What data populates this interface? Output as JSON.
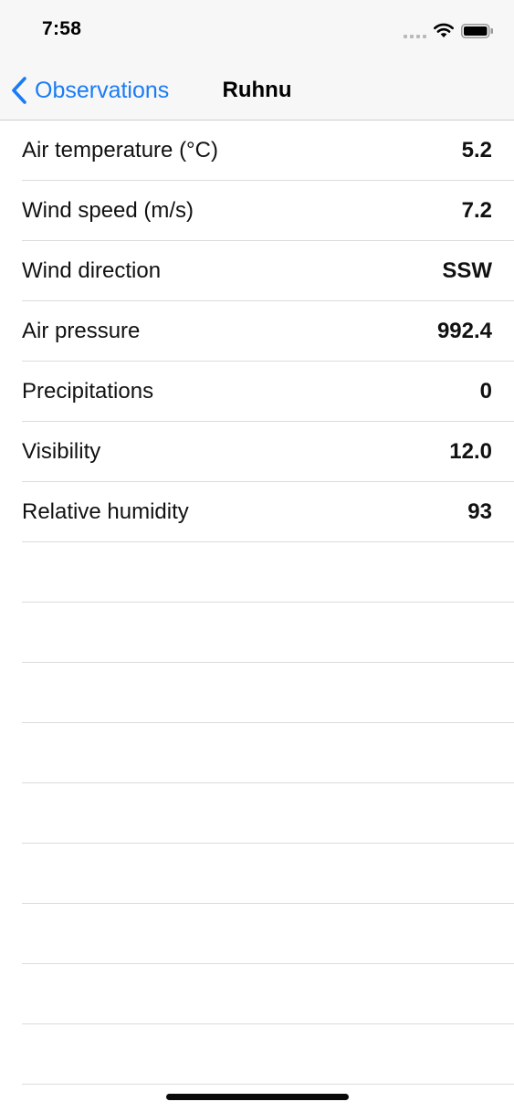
{
  "status_bar": {
    "time": "7:58"
  },
  "nav": {
    "back_label": "Observations",
    "title": "Ruhnu"
  },
  "observations": [
    {
      "label": "Air temperature (°C)",
      "value": "5.2"
    },
    {
      "label": "Wind speed (m/s)",
      "value": "7.2"
    },
    {
      "label": "Wind direction",
      "value": "SSW"
    },
    {
      "label": "Air pressure",
      "value": "992.4"
    },
    {
      "label": "Precipitations",
      "value": "0"
    },
    {
      "label": "Visibility",
      "value": "12.0"
    },
    {
      "label": "Relative humidity",
      "value": "93"
    }
  ],
  "empty_rows": 9,
  "colors": {
    "accent": "#1a7cf5",
    "separator": "#dcdcdc",
    "nav_background": "#f7f7f7"
  },
  "icons": {
    "back": "chevron-left-icon",
    "wifi": "wifi-icon",
    "battery": "battery-icon",
    "signal": "signal-icon"
  }
}
